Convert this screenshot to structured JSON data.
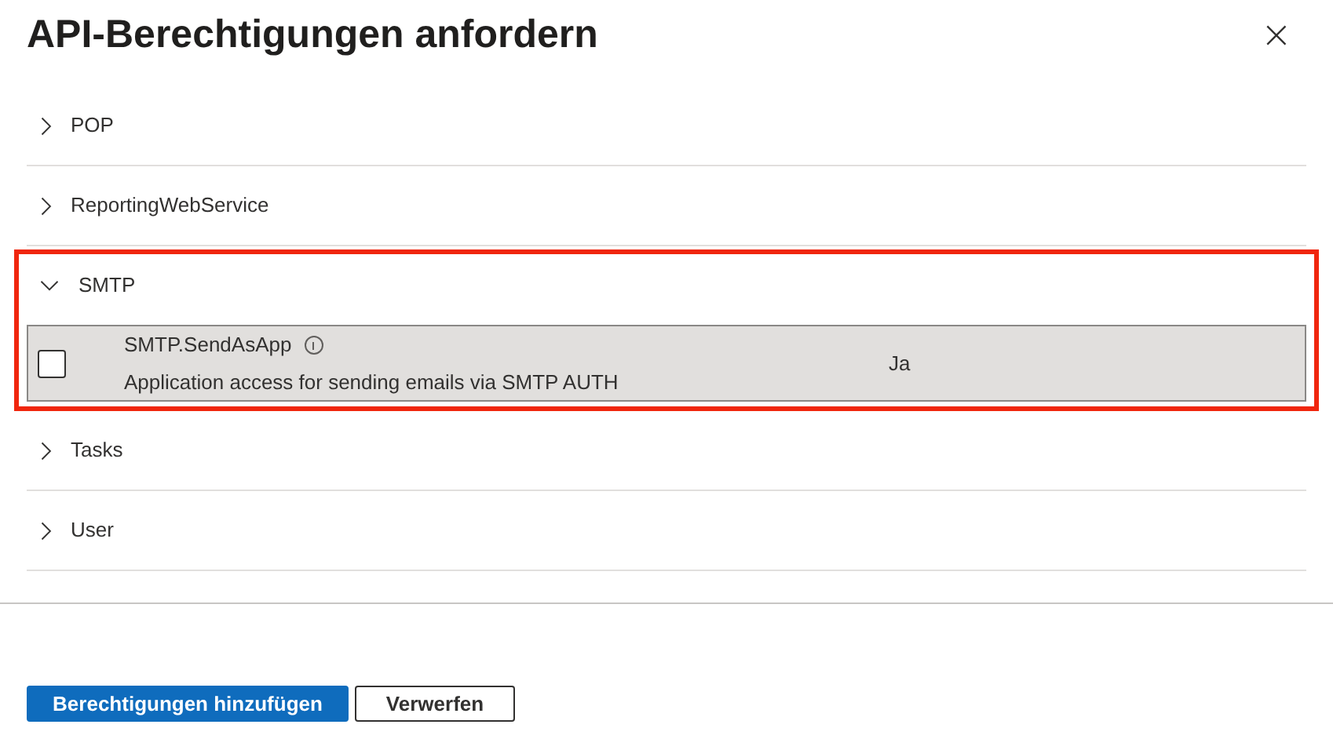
{
  "panel": {
    "title": "API-Berechtigungen anfordern",
    "close": "×"
  },
  "groups": [
    {
      "name": "POP",
      "expanded": false,
      "highlighted": false
    },
    {
      "name": "ReportingWebService",
      "expanded": false,
      "highlighted": false
    },
    {
      "name": "SMTP",
      "expanded": true,
      "highlighted": true,
      "permissions": [
        {
          "name": "SMTP.SendAsApp",
          "description": "Application access for sending emails via SMTP AUTH",
          "admin_consent": "Ja",
          "checked": false,
          "selected": true
        }
      ]
    },
    {
      "name": "Tasks",
      "expanded": false,
      "highlighted": false
    },
    {
      "name": "User",
      "expanded": false,
      "highlighted": false
    }
  ],
  "buttons": [
    {
      "label": "Berechtigungen hinzufügen",
      "kind": "primary"
    },
    {
      "label": "Verwerfen",
      "kind": "secondary"
    }
  ]
}
